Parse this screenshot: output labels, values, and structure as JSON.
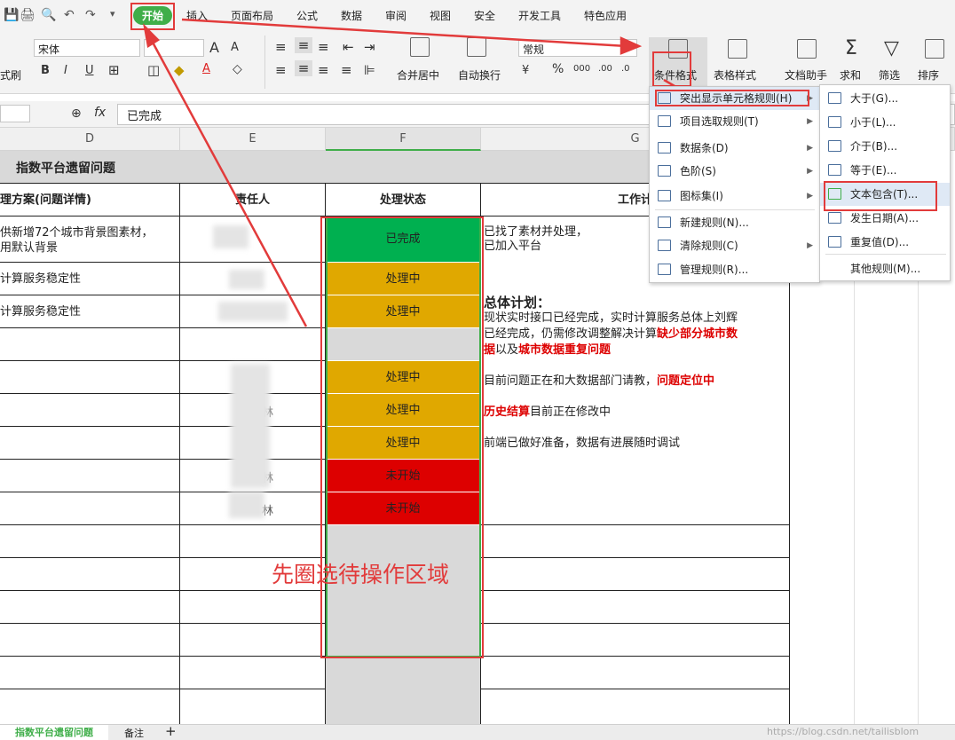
{
  "quick_access": [
    "💾",
    "🖨",
    "🔍",
    "↶",
    "↷",
    "▾"
  ],
  "tabs": [
    {
      "label": "开始",
      "active": true
    },
    {
      "label": "插入"
    },
    {
      "label": "页面布局"
    },
    {
      "label": "公式"
    },
    {
      "label": "数据"
    },
    {
      "label": "审阅"
    },
    {
      "label": "视图"
    },
    {
      "label": "安全"
    },
    {
      "label": "开发工具"
    },
    {
      "label": "特色应用"
    }
  ],
  "ribbon": {
    "font_name": "宋体",
    "number_format": "常规",
    "format_painter_label": "式刷",
    "merge_label": "合并居中",
    "wrap_label": "自动换行",
    "conditional_format_label": "条件格式",
    "table_style_label": "表格样式",
    "doc_assistant_label": "文档助手",
    "sum_label": "求和",
    "filter_label": "筛选",
    "sort_label": "排序",
    "bold": "B",
    "italic": "I",
    "underline": "U",
    "font_grow": "A",
    "font_shrink": "A",
    "percent": "%",
    "comma": "000",
    "dec_inc": ".00",
    "dec_dec": ".0"
  },
  "formula_bar": {
    "fx": "fx",
    "value": "已完成"
  },
  "columns": [
    "D",
    "E",
    "F",
    "G"
  ],
  "sheet": {
    "title": "指数平台遗留问题",
    "headers": {
      "solution": "理方案(问题详情)",
      "owner": "责任人",
      "status": "处理状态",
      "plan": "工作计"
    },
    "rows": [
      {
        "solution": "供新增72个城市背景图素材，\n用默认背景",
        "status": "已完成",
        "work": "已找了素材并处理，\n已加入平台",
        "status_color": "#00b050"
      },
      {
        "solution": "计算服务稳定性",
        "status": "处理中",
        "status_color": "#e0a800"
      },
      {
        "solution": "计算服务稳定性",
        "status": "处理中",
        "status_color": "#e0a800"
      },
      {
        "solution": "",
        "status": "",
        "status_color": "#d9d9d9"
      },
      {
        "solution": "",
        "status": "处理中",
        "status_color": "#e0a800"
      },
      {
        "solution": "",
        "status": "处理中",
        "status_color": "#e0a800"
      },
      {
        "solution": "",
        "status": "处理中",
        "status_color": "#e0a800"
      },
      {
        "solution": "",
        "status": "未开始",
        "status_color": "#dd0000"
      },
      {
        "solution": "",
        "status": "未开始",
        "status_color": "#dd0000"
      }
    ],
    "owner_fragments": [
      "林",
      "林",
      "林"
    ],
    "plan_heading": "总体计划：",
    "plan_line1": "现状实时接口已经完成，实时计算服务总体上刘辉",
    "plan_line2a": "已经完成，仍需修改调整解决计算",
    "plan_line2b": "缺少部分城市数",
    "plan_line3a": "据",
    "plan_line3b": "以及",
    "plan_line3c": "城市数据重复问题",
    "plan_line4a": "目前问题正在和大数据部门请教，",
    "plan_line4b": "问题定位中",
    "plan_line5a": "历史结算",
    "plan_line5b": "目前正在修改中",
    "plan_line6": "前端已做好准备，数据有进展随时调试"
  },
  "annotation": "先圈选待操作区域",
  "cf_menu": [
    {
      "label": "突出显示单元格规则(H)",
      "arrow": true
    },
    {
      "label": "项目选取规则(T)",
      "arrow": true
    },
    {
      "label": "数据条(D)",
      "arrow": true
    },
    {
      "label": "色阶(S)",
      "arrow": true
    },
    {
      "label": "图标集(I)",
      "arrow": true
    },
    {
      "label": "新建规则(N)..."
    },
    {
      "label": "清除规则(C)",
      "arrow": true
    },
    {
      "label": "管理规则(R)..."
    }
  ],
  "sub_menu": [
    {
      "label": "大于(G)..."
    },
    {
      "label": "小于(L)..."
    },
    {
      "label": "介于(B)..."
    },
    {
      "label": "等于(E)..."
    },
    {
      "label": "文本包含(T)..."
    },
    {
      "label": "发生日期(A)..."
    },
    {
      "label": "重复值(D)..."
    },
    {
      "label": "其他规则(M)..."
    }
  ],
  "sheet_tabs": [
    "指数平台遗留问题",
    "备注"
  ],
  "watermark": "https://blog.csdn.net/tailisblom",
  "colors": {
    "accent_green": "#3fae49",
    "annotation_red": "#e23b3b",
    "done": "#00b050",
    "in_progress": "#e0a800",
    "not_started": "#dd0000",
    "empty": "#d9d9d9"
  }
}
